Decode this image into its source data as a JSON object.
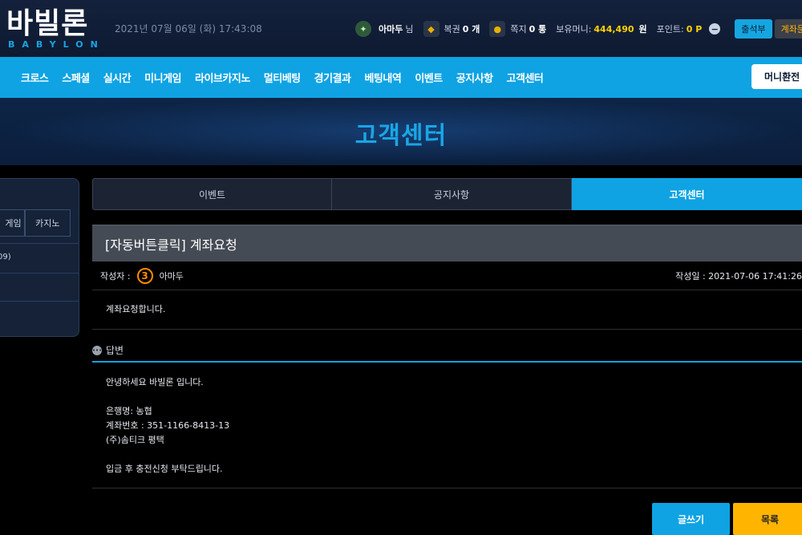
{
  "header": {
    "logo_ko": "바빌론",
    "logo_en": "BABYLON",
    "datetime": "2021년 07월 06일 (화) 17:43:08",
    "user": {
      "name": "아마두",
      "name_suffix": "님",
      "coupon_label": "복권",
      "coupon_count": "0 개",
      "msg_label": "쪽지",
      "msg_count": "0 통",
      "money_label": "보유머니:",
      "money_value": "444,490",
      "money_unit": "원",
      "point_label": "포인트:",
      "point_value": "0 P"
    },
    "attend_button": "출석부",
    "account_button": "계좌문의"
  },
  "nav": {
    "items": [
      "크로스",
      "스페셜",
      "실시간",
      "미니게임",
      "라이브카지노",
      "멀티베팅",
      "경기결과",
      "베팅내역",
      "이벤트",
      "공지사항",
      "고객센터"
    ],
    "money_button": "머니환전"
  },
  "banner": {
    "title": "고객센터"
  },
  "sidebar": {
    "tab_minigame": "게임",
    "tab_casino": "카지노",
    "row_text": "09)"
  },
  "tabs": {
    "event": "이벤트",
    "notice": "공지사항",
    "support": "고객센터",
    "active": "support"
  },
  "post": {
    "title": "[자동버튼클릭] 계좌요청",
    "author_label": "작성자 :",
    "author_level": "3",
    "author_name": "아마두",
    "date_label": "작성일 :",
    "date_value": "2021-07-06 17:41:26",
    "body": "계좌요청합니다."
  },
  "answer": {
    "label": "답변",
    "greeting": "안녕하세요 바빌론 입니다.",
    "bank": "은행명: 농협",
    "account": "계좌번호 : 351-1166-8413-13",
    "holder": "(주)솜티크 평택",
    "closing": "입금 후 충전신청 부탁드립니다."
  },
  "buttons": {
    "write": "글쓰기",
    "list": "목록"
  },
  "colors": {
    "accent": "#0fa3e3",
    "list_button": "#ffb400",
    "author_badge": "#ff8a00"
  }
}
